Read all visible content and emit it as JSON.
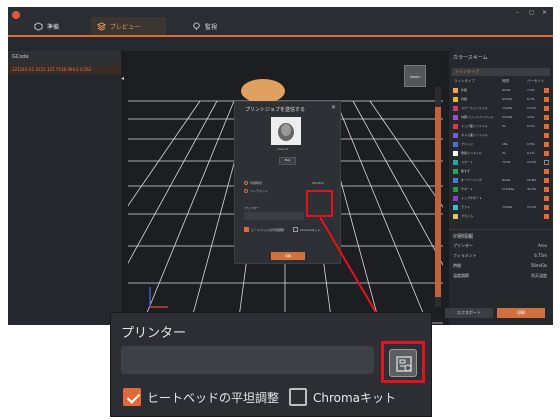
{
  "tabs": [
    {
      "label": "準備"
    },
    {
      "label": "プレビュー"
    },
    {
      "label": "監視"
    }
  ],
  "left_panel": {
    "title": "GCode",
    "line": "121140  G1 X151.121 Y148.999 E 0.362"
  },
  "viewcube": {
    "label": "FRONT"
  },
  "dialog": {
    "title": "プリントジョブを送信する",
    "model_caption": "mascot",
    "plate": "PLA",
    "time_label": "印刷時間",
    "time_value": "56m43s",
    "filament_label": "フィラメント",
    "filament_value": "6.75m",
    "printer_label": "プリンター",
    "bed_level_label": "ヒートベッドの平坦調整",
    "chroma_label": "Chromaキット",
    "send_label": "印刷"
  },
  "right_panel": {
    "title": "カラースキーム",
    "scheme": "ラインタイプ",
    "columns": [
      "ラインタイプ",
      "時間",
      "パーセント"
    ],
    "rows": [
      {
        "name": "外壁",
        "time": "4m4s",
        "pct": "7.2%",
        "color": "#f2a05e",
        "on": true
      },
      {
        "name": "内壁",
        "time": "3m47s",
        "pct": "6.7%",
        "color": "#e2b93a",
        "on": true
      },
      {
        "name": "スパースインフィル",
        "time": "7m23s",
        "pct": "13.0%",
        "color": "#cc3a7a",
        "on": true
      },
      {
        "name": "内部ソリッドインフィル",
        "time": "2m33s",
        "pct": "4.5%",
        "color": "#a44dbf",
        "on": true
      },
      {
        "name": "トップ面インフィル",
        "time": "3s",
        "pct": "0.1%",
        "color": "#e0383b",
        "on": true
      },
      {
        "name": "ボトム面インフィル",
        "time": "",
        "pct": "",
        "color": "#7a5cd6",
        "on": true
      },
      {
        "name": "ブリッジ",
        "time": "18s",
        "pct": "0.5%",
        "color": "#4a6fd0",
        "on": true
      },
      {
        "name": "隙間インフィル",
        "time": "3s",
        "pct": "0.1%",
        "color": "#ffffff",
        "on": true
      },
      {
        "name": "スカート",
        "time": "7m3s",
        "pct": "12.4%",
        "color": "#2aa6a0",
        "on": false
      },
      {
        "name": "筋すぎ",
        "time": "",
        "pct": "",
        "color": "#2da05a",
        "on": true
      },
      {
        "name": "オーバーハング",
        "time": "6m9s",
        "pct": "10.8%",
        "color": "#3f7fd8",
        "on": true
      },
      {
        "name": "サポート",
        "time": "17m16s",
        "pct": "30.5%",
        "color": "#2d9c3c",
        "on": true
      },
      {
        "name": "トップサポート",
        "time": "",
        "pct": "",
        "color": "#8d3cd6",
        "on": true
      },
      {
        "name": "ラフト",
        "time": "7m32s",
        "pct": "13.3%",
        "color": "#2cc0d8",
        "on": true
      },
      {
        "name": "プライム",
        "time": "",
        "pct": "",
        "color": "#e3c45a",
        "on": true
      }
    ],
    "print_info_title": "印刷情報",
    "print_info": [
      {
        "label": "プリンター",
        "value": "Arco"
      },
      {
        "label": "フィラメント",
        "value": "6.75m"
      },
      {
        "label": "時間",
        "value": "56m43s"
      },
      {
        "label": "温度調節",
        "value": "尚天温度"
      }
    ],
    "export_label": "エクスポート",
    "print_label": "印刷"
  },
  "zoom": {
    "printer_label": "プリンター",
    "bed_level_label": "ヒートベッドの平坦調整",
    "bed_level_checked": true,
    "chroma_label": "Chromaキット",
    "chroma_checked": false
  },
  "colors": {
    "accent": "#e06a3a",
    "highlight": "#e8101c",
    "background": "#1b1d21"
  }
}
